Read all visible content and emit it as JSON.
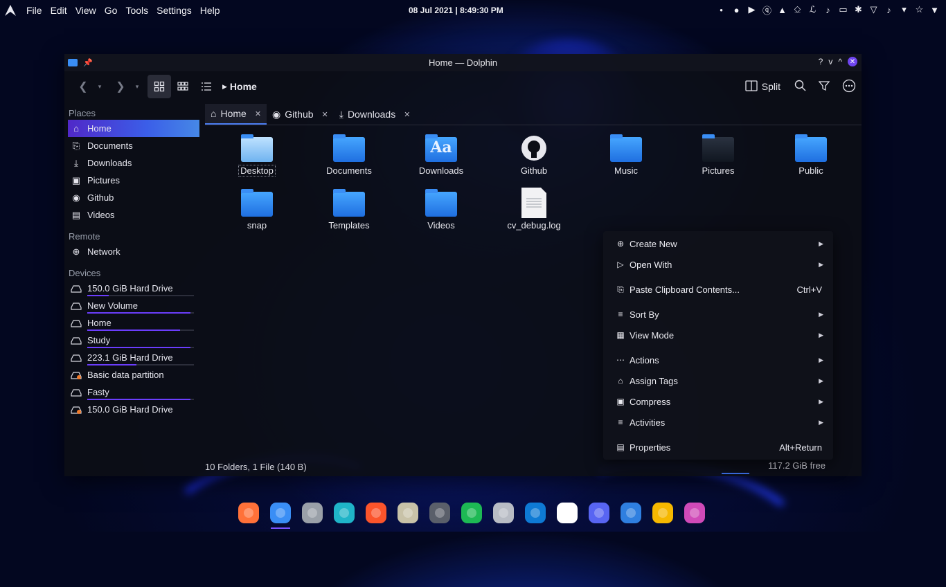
{
  "topbar": {
    "menu": [
      "File",
      "Edit",
      "View",
      "Go",
      "Tools",
      "Settings",
      "Help"
    ],
    "clock": "08 Jul 2021 | 8:49:30 PM",
    "tray_icons": [
      "droplet-icon",
      "record-icon",
      "play-icon",
      "qbittorrent-icon",
      "vlc-icon",
      "usb-icon",
      "paperclip-icon",
      "volume-icon",
      "battery-icon",
      "bluetooth-icon",
      "wifi-icon",
      "volume-icon",
      "chevron-down-icon",
      "star-icon",
      "dropdown-icon"
    ]
  },
  "window": {
    "title": "Home — Dolphin",
    "controls": [
      "?",
      "v",
      "^"
    ]
  },
  "toolbar": {
    "breadcrumb": "Home",
    "split_label": "Split"
  },
  "sidebar": {
    "places_title": "Places",
    "places": [
      {
        "label": "Home",
        "icon": "home-icon",
        "selected": true
      },
      {
        "label": "Documents",
        "icon": "documents-icon"
      },
      {
        "label": "Downloads",
        "icon": "downloads-icon"
      },
      {
        "label": "Pictures",
        "icon": "pictures-icon"
      },
      {
        "label": "Github",
        "icon": "github-icon"
      },
      {
        "label": "Videos",
        "icon": "videos-icon"
      }
    ],
    "remote_title": "Remote",
    "remote": [
      {
        "label": "Network",
        "icon": "network-icon"
      }
    ],
    "devices_title": "Devices",
    "devices": [
      {
        "label": "150.0 GiB Hard Drive",
        "used": 0.2,
        "warn": false
      },
      {
        "label": "New Volume",
        "used": 0.97,
        "warn": false
      },
      {
        "label": "Home",
        "used": 0.87,
        "warn": false
      },
      {
        "label": "Study",
        "used": 0.97,
        "warn": false
      },
      {
        "label": "223.1 GiB Hard Drive",
        "used": 0.46,
        "warn": false
      },
      {
        "label": "Basic data partition",
        "used": null,
        "warn": true
      },
      {
        "label": "Fasty",
        "used": 0.97,
        "warn": false
      },
      {
        "label": "150.0 GiB Hard Drive",
        "used": null,
        "warn": true
      }
    ]
  },
  "tabs": [
    {
      "label": "Home",
      "icon": "home-icon",
      "active": true
    },
    {
      "label": "Github",
      "icon": "github-icon",
      "active": false
    },
    {
      "label": "Downloads",
      "icon": "downloads-icon",
      "active": false
    }
  ],
  "files": [
    {
      "name": "Desktop",
      "kind": "desktop"
    },
    {
      "name": "Documents",
      "kind": "folder"
    },
    {
      "name": "Downloads",
      "kind": "downloads"
    },
    {
      "name": "Github",
      "kind": "github"
    },
    {
      "name": "Music",
      "kind": "folder"
    },
    {
      "name": "Pictures",
      "kind": "pictures"
    },
    {
      "name": "Public",
      "kind": "folder"
    },
    {
      "name": "snap",
      "kind": "folder"
    },
    {
      "name": "Templates",
      "kind": "folder"
    },
    {
      "name": "Videos",
      "kind": "folder"
    },
    {
      "name": "cv_debug.log",
      "kind": "file"
    }
  ],
  "status": {
    "summary": "10 Folders, 1 File (140 B)",
    "free": "117.2 GiB free"
  },
  "context_menu": [
    {
      "label": "Create New",
      "icon": "create-new-icon",
      "submenu": true,
      "shortcut": ""
    },
    {
      "label": "Open With",
      "icon": "open-with-icon",
      "submenu": true,
      "shortcut": ""
    },
    {
      "label": "Paste Clipboard Contents...",
      "icon": "paste-icon",
      "submenu": false,
      "shortcut": "Ctrl+V"
    },
    {
      "label": "Sort By",
      "icon": "sort-icon",
      "submenu": true,
      "shortcut": ""
    },
    {
      "label": "View Mode",
      "icon": "view-mode-icon",
      "submenu": true,
      "shortcut": ""
    },
    {
      "label": "Actions",
      "icon": "actions-icon",
      "submenu": true,
      "shortcut": ""
    },
    {
      "label": "Assign Tags",
      "icon": "tag-icon",
      "submenu": true,
      "shortcut": ""
    },
    {
      "label": "Compress",
      "icon": "compress-icon",
      "submenu": true,
      "shortcut": ""
    },
    {
      "label": "Activities",
      "icon": "activities-icon",
      "submenu": true,
      "shortcut": ""
    },
    {
      "label": "Properties",
      "icon": "properties-icon",
      "submenu": false,
      "shortcut": "Alt+Return"
    }
  ],
  "dock": [
    {
      "name": "firefox-icon",
      "color": "#ff7139",
      "running": false
    },
    {
      "name": "dolphin-icon",
      "color": "#3a8ef5",
      "running": true
    },
    {
      "name": "terminal-icon",
      "color": "#9aa0a8",
      "running": false
    },
    {
      "name": "edge-dev-icon",
      "color": "#1fb4c8",
      "running": false
    },
    {
      "name": "brave-icon",
      "color": "#fb542b",
      "running": false
    },
    {
      "name": "usb-creator-icon",
      "color": "#c8c2a8",
      "running": false
    },
    {
      "name": "settings-icon",
      "color": "#5a5f6a",
      "running": false
    },
    {
      "name": "spotify-icon",
      "color": "#1db954",
      "running": false
    },
    {
      "name": "inkscape-icon",
      "color": "#b8bcc4",
      "running": false
    },
    {
      "name": "vscode-icon",
      "color": "#0e7ad4",
      "running": false
    },
    {
      "name": "slack-icon",
      "color": "#ffffff",
      "running": false
    },
    {
      "name": "discord-icon",
      "color": "#5865f2",
      "running": false
    },
    {
      "name": "qbittorrent-icon",
      "color": "#2f7fe0",
      "running": false
    },
    {
      "name": "disk-usage-icon",
      "color": "#f6b800",
      "running": false
    },
    {
      "name": "crop-icon",
      "color": "#d04ab8",
      "running": false
    }
  ]
}
